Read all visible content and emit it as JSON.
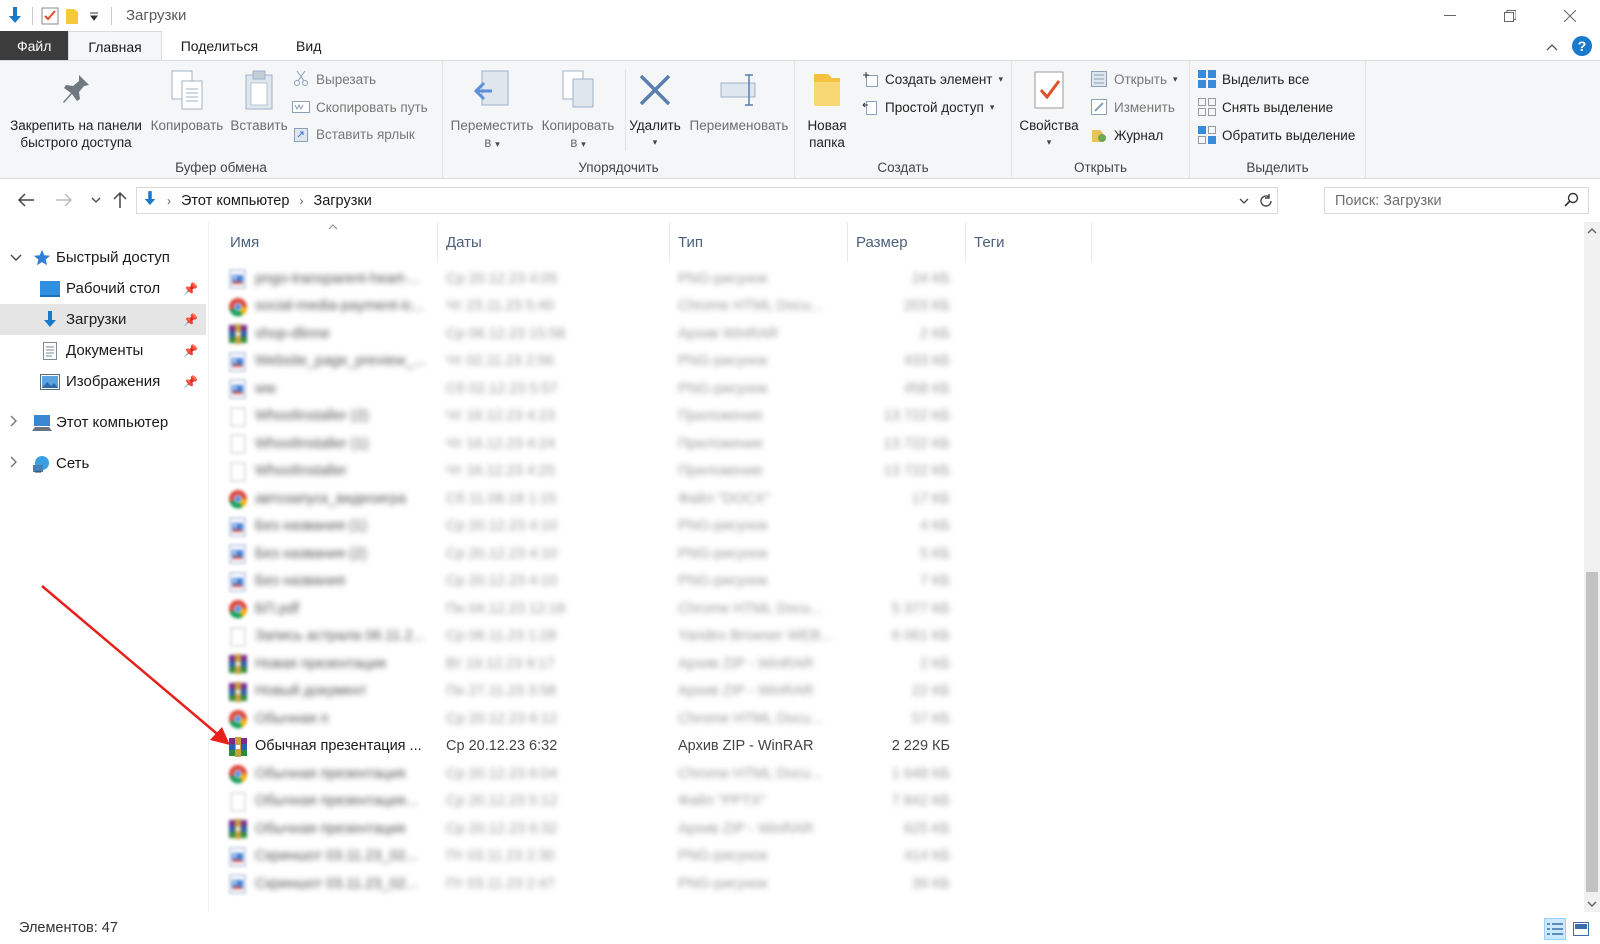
{
  "window": {
    "title": "Загрузки",
    "controls": [
      "—",
      "❐",
      "✕"
    ]
  },
  "tabs": {
    "file": "Файл",
    "home": "Главная",
    "share": "Поделиться",
    "view": "Вид"
  },
  "ribbon": {
    "clipboard": {
      "label": "Буфер обмена",
      "pin": [
        "Закрепить на панели",
        "быстрого доступа"
      ],
      "copy": "Копировать",
      "paste": "Вставить",
      "cut": "Вырезать",
      "copy_path": "Скопировать путь",
      "paste_shortcut": "Вставить ярлык"
    },
    "organize": {
      "label": "Упорядочить",
      "move": [
        "Переместить",
        "в"
      ],
      "copy_to": [
        "Копировать",
        "в"
      ],
      "delete": "Удалить",
      "rename": "Переименовать"
    },
    "create": {
      "label": "Создать",
      "new_folder": [
        "Новая",
        "папка"
      ],
      "new_item": "Создать элемент",
      "easy_access": "Простой доступ"
    },
    "open": {
      "label": "Открыть",
      "properties": "Свойства",
      "open": "Открыть",
      "edit": "Изменить",
      "history": "Журнал"
    },
    "select": {
      "label": "Выделить",
      "select_all": "Выделить все",
      "select_none": "Снять выделение",
      "invert": "Обратить выделение"
    }
  },
  "address": {
    "crumbs": [
      "Этот компьютер",
      "Загрузки"
    ],
    "search_placeholder": "Поиск: Загрузки"
  },
  "navpane": {
    "quick_access": "Быстрый доступ",
    "items": [
      {
        "label": "Рабочий стол",
        "icon": "desktop-icon"
      },
      {
        "label": "Загрузки",
        "icon": "downloads-icon"
      },
      {
        "label": "Документы",
        "icon": "documents-icon"
      },
      {
        "label": "Изображения",
        "icon": "pictures-icon"
      }
    ],
    "this_pc": "Этот компьютер",
    "network": "Сеть"
  },
  "columns": {
    "name": "Имя",
    "date": "Даты",
    "type": "Тип",
    "size": "Размер",
    "tags": "Теги"
  },
  "files": [
    {
      "name": "pngo-transparent-heart-...",
      "date": "Ср 20.12.23 4:05",
      "type": "PNG-рисунок",
      "size": "24 КБ",
      "icon": "png",
      "blur": true
    },
    {
      "name": "social-media-payment-ic...",
      "date": "Чт 23.11.23 5:40",
      "type": "Chrome HTML Docu...",
      "size": "203 КБ",
      "icon": "chrome",
      "blur": true
    },
    {
      "name": "shop-dlinne",
      "date": "Ср 06.12.23 15:58",
      "type": "Архив WinRAR",
      "size": "2 КБ",
      "icon": "rar",
      "blur": true
    },
    {
      "name": "Website_page_preview_...",
      "date": "Чт 02.11.23 2:56",
      "type": "PNG-рисунок",
      "size": "433 КБ",
      "icon": "png",
      "blur": true
    },
    {
      "name": "ww",
      "date": "Сб 02.12.23 5:57",
      "type": "PNG-рисунок",
      "size": "458 КБ",
      "icon": "png",
      "blur": true
    },
    {
      "name": "WhoolInstaller (2)",
      "date": "Чт 16.12.23 4:23",
      "type": "Приложение",
      "size": "13 722 КБ",
      "icon": "blank",
      "blur": true
    },
    {
      "name": "WhoolInstaller (1)",
      "date": "Чт 16.12.23 4:24",
      "type": "Приложение",
      "size": "13 722 КБ",
      "icon": "blank",
      "blur": true
    },
    {
      "name": "WhoolInstaller",
      "date": "Чт 16.12.23 4:25",
      "type": "Приложение",
      "size": "13 722 КБ",
      "icon": "blank",
      "blur": true
    },
    {
      "name": "автозапуск_видеоигра",
      "date": "Сб 11.08.18 1:15",
      "type": "Файл \"DOCX\"",
      "size": "17 КБ",
      "icon": "chrome",
      "blur": true
    },
    {
      "name": "Без названия (1)",
      "date": "Ср 20.12.23 4:10",
      "type": "PNG-рисунок",
      "size": "4 КБ",
      "icon": "png",
      "blur": true
    },
    {
      "name": "Без названия (2)",
      "date": "Ср 20.12.23 4:10",
      "type": "PNG-рисунок",
      "size": "5 КБ",
      "icon": "png",
      "blur": true
    },
    {
      "name": "Без названия",
      "date": "Ср 20.12.23 4:10",
      "type": "PNG-рисунок",
      "size": "7 КБ",
      "icon": "png",
      "blur": true
    },
    {
      "name": "БП.pdf",
      "date": "Пн 04.12.23 12:18",
      "type": "Chrome HTML Docu...",
      "size": "5 377 КБ",
      "icon": "chrome",
      "blur": true
    },
    {
      "name": "Запись астрала 06.11.2...",
      "date": "Ср 06.11.23 1:28",
      "type": "Yandex Browser WEB...",
      "size": "6 061 КБ",
      "icon": "blank",
      "blur": true
    },
    {
      "name": "Новая презентация",
      "date": "Вт 19.12.23 9:17",
      "type": "Архив ZIP - WinRAR",
      "size": "2 КБ",
      "icon": "rar",
      "blur": true
    },
    {
      "name": "Новый документ",
      "date": "Пн 27.11.23 3:58",
      "type": "Архив ZIP - WinRAR",
      "size": "22 КБ",
      "icon": "rar",
      "blur": true
    },
    {
      "name": "Обычная п",
      "date": "Ср 20.12.23 6:12",
      "type": "Chrome HTML Docu...",
      "size": "57 КБ",
      "icon": "chrome",
      "blur": true
    },
    {
      "name": "Обычная презентация ...",
      "date": "Ср 20.12.23 6:32",
      "type": "Архив ZIP - WinRAR",
      "size": "2 229 КБ",
      "icon": "rar",
      "blur": false
    },
    {
      "name": "Обычная презентация",
      "date": "Ср 20.12.23 6:04",
      "type": "Chrome HTML Docu...",
      "size": "1 648 КБ",
      "icon": "chrome",
      "blur": true
    },
    {
      "name": "Обычная презентация...",
      "date": "Ср 20.12.23 5:12",
      "type": "Файл \"PPTX\"",
      "size": "7 842 КБ",
      "icon": "blank",
      "blur": true
    },
    {
      "name": "Обычная презентация",
      "date": "Ср 20.12.23 6:32",
      "type": "Архив ZIP - WinRAR",
      "size": "625 КБ",
      "icon": "rar",
      "blur": true
    },
    {
      "name": "Скриншот 03.11.23_02...",
      "date": "Пт 03.11.23 2:30",
      "type": "PNG-рисунок",
      "size": "414 КБ",
      "icon": "png",
      "blur": true
    },
    {
      "name": "Скриншот 03.11.23_02...",
      "date": "Пт 03.11.23 2:47",
      "type": "PNG-рисунок",
      "size": "39 КБ",
      "icon": "png",
      "blur": true
    }
  ],
  "status": {
    "count": "Элементов: 47"
  },
  "colors": {
    "accent": "#1979ca",
    "annotation_arrow": "#e8201c",
    "selection": "#cce8ff"
  }
}
